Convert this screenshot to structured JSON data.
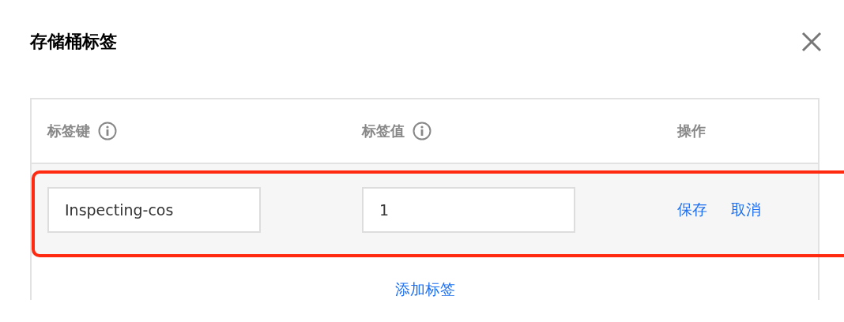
{
  "dialog": {
    "title": "存储桶标签"
  },
  "table": {
    "columns": [
      {
        "label": "标签键",
        "info": true
      },
      {
        "label": "标签值",
        "info": true
      },
      {
        "label": "操作",
        "info": false
      }
    ],
    "rows": [
      {
        "key": "Inspecting-cos",
        "value": "1",
        "actions": [
          "保存",
          "取消"
        ],
        "highlighted": true
      }
    ],
    "add_link": "添加标签"
  }
}
